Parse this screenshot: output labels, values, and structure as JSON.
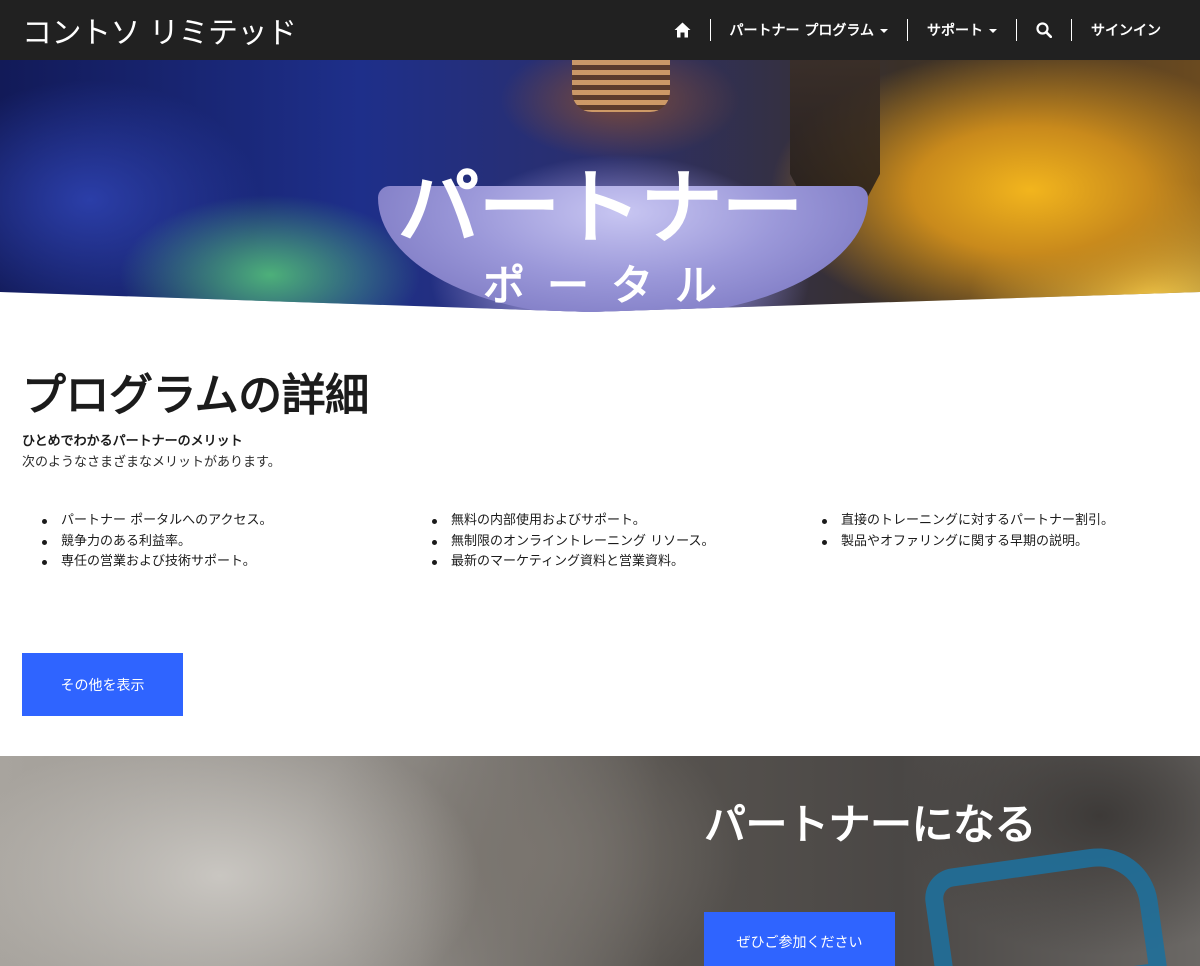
{
  "header": {
    "brand": "コントソ リミテッド",
    "nav": [
      {
        "label": "パートナー プログラム",
        "has_dropdown": true
      },
      {
        "label": "サポート",
        "has_dropdown": true
      }
    ],
    "home_icon": "home-icon",
    "search_icon": "search-icon",
    "signin_label": "サインイン"
  },
  "hero": {
    "title": "パートナー",
    "subtitle": "ポータル"
  },
  "details": {
    "title": "プログラムの詳細",
    "subhead": "ひとめでわかるパートナーのメリット",
    "description": "次のようなさまざまなメリットがあります。",
    "columns": [
      [
        "パートナー ポータルへのアクセス。",
        "競争力のある利益率。",
        "専任の営業および技術サポート。"
      ],
      [
        "無料の内部使用およびサポート。",
        "無制限のオンライントレーニング リソース。",
        "最新のマーケティング資料と営業資料。"
      ],
      [
        "直接のトレーニングに対するパートナー割引。",
        "製品やオファリングに関する早期の説明。"
      ]
    ],
    "more_button": "その他を表示"
  },
  "join": {
    "title": "パートナーになる",
    "button": "ぜひご参加ください"
  },
  "colors": {
    "nav_bg": "#212121",
    "accent": "#2f64ff",
    "text": "#1b1b1b"
  }
}
